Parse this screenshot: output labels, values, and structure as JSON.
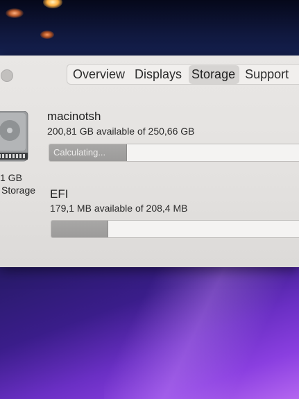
{
  "tabs": [
    {
      "label": "Overview",
      "active": false
    },
    {
      "label": "Displays",
      "active": false
    },
    {
      "label": "Storage",
      "active": true
    },
    {
      "label": "Support",
      "active": false
    }
  ],
  "sidebar": {
    "capacity": "1 GB",
    "label": "Storage"
  },
  "volumes": [
    {
      "name": "macinotsh",
      "available": "200,81 GB available of 250,66 GB",
      "bar_text": "Calculating...",
      "bar_fill_fraction": 0.3
    },
    {
      "name": "EFI",
      "available": "179,1 MB available of 208,4 MB",
      "bar_text": "",
      "bar_fill_fraction": 0.22
    }
  ],
  "colors": {
    "window_bg": "#e6e4e2",
    "bar_fill": "#a3a2a1",
    "desktop_purple": "#7a35d4"
  }
}
